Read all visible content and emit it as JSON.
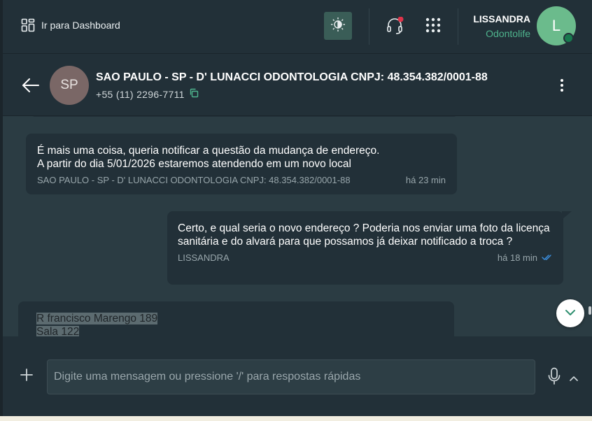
{
  "topbar": {
    "dashboard_label": "Ir para Dashboard",
    "user_name": "LISSANDRA",
    "user_org": "Odontolife",
    "avatar_initial": "L",
    "accent_color": "#4fb58e",
    "notification_color": "#e0334a"
  },
  "chat_header": {
    "contact_initials": "SP",
    "contact_name": "SAO PAULO - SP - D' LUNACCI ODONTOLOGIA CNPJ: 48.354.382/0001-88",
    "contact_phone": "+55 (11) 2296-7711"
  },
  "messages": [
    {
      "direction": "incoming",
      "text": "É mais uma coisa, queria notificar a questão da mudança de endereço.\nA partir do dia 5/01/2026 estaremos atendendo em um novo local",
      "sender": "SAO PAULO - SP - D' LUNACCI ODONTOLOGIA CNPJ: 48.354.382/0001-88",
      "time": "há 23 min"
    },
    {
      "direction": "outgoing",
      "text": "Certo, e qual seria o novo endereço ? Poderia nos enviar uma foto da licença sanitária e do alvará para que possamos já deixar notificado a troca ?",
      "sender": "LISSANDRA",
      "time": "há 18 min",
      "status": "read"
    },
    {
      "direction": "incoming",
      "lines": [
        "R francisco Marengo 189",
        "Sala 122"
      ]
    }
  ],
  "composer": {
    "placeholder": "Digite uma mensagem ou pressione '/' para respostas rápidas"
  }
}
